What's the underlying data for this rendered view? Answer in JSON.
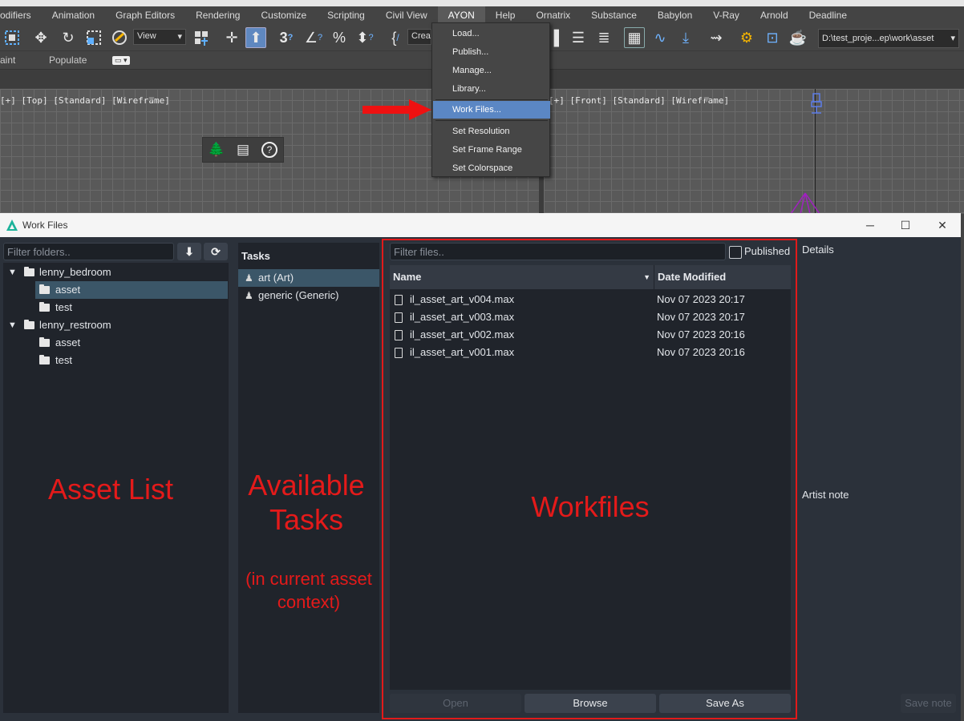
{
  "menubar": {
    "items": [
      "odifiers",
      "Animation",
      "Graph Editors",
      "Rendering",
      "Customize",
      "Scripting",
      "Civil View",
      "AYON",
      "Help",
      "Ornatrix",
      "Substance",
      "Babylon",
      "V-Ray",
      "Arnold",
      "Deadline"
    ],
    "active": "AYON"
  },
  "toolbar": {
    "view_select": "View",
    "create_select": "Crea",
    "project_path": "D:\\test_proje...ep\\work\\asset"
  },
  "subbar": {
    "left_label": "aint",
    "populate_label": "Populate"
  },
  "viewports": {
    "left_label": "[+] [Top] [Standard] [Wireframe]",
    "right_label": "[+] [Front] [Standard] [Wireframe]"
  },
  "ayon_menu": {
    "items": [
      "Load...",
      "Publish...",
      "Manage...",
      "Library...",
      "Work Files...",
      "Set Resolution",
      "Set Frame Range",
      "Set Colorspace"
    ],
    "highlighted": "Work Files..."
  },
  "workfiles": {
    "window_title": "Work Files",
    "folders": {
      "filter_placeholder": "Filter folders..",
      "tree": [
        {
          "label": "lenny_bedroom",
          "expanded": true,
          "children": [
            {
              "label": "asset",
              "selected": true
            },
            {
              "label": "test"
            }
          ]
        },
        {
          "label": "lenny_restroom",
          "expanded": true,
          "children": [
            {
              "label": "asset"
            },
            {
              "label": "test"
            }
          ]
        }
      ]
    },
    "tasks": {
      "header": "Tasks",
      "items": [
        {
          "label": "art (Art)",
          "selected": true
        },
        {
          "label": "generic (Generic)"
        }
      ]
    },
    "files": {
      "filter_placeholder": "Filter files..",
      "published_label": "Published",
      "columns": [
        "Name",
        "Date Modified"
      ],
      "rows": [
        {
          "name": "il_asset_art_v004.max",
          "date": "Nov 07 2023 20:17"
        },
        {
          "name": "il_asset_art_v003.max",
          "date": "Nov 07 2023 20:17"
        },
        {
          "name": "il_asset_art_v002.max",
          "date": "Nov 07 2023 20:16"
        },
        {
          "name": "il_asset_art_v001.max",
          "date": "Nov 07 2023 20:16"
        }
      ],
      "buttons": {
        "open": "Open",
        "browse": "Browse",
        "save_as": "Save As"
      }
    },
    "details": {
      "header": "Details",
      "artist_note": "Artist note",
      "save_note": "Save note"
    }
  },
  "annotations": {
    "asset_list": "Asset List",
    "available_tasks_line1": "Available",
    "available_tasks_line2": "Tasks",
    "context_line1": "(in current asset",
    "context_line2": "context)",
    "workfiles": "Workfiles"
  },
  "colors": {
    "annotation_red": "#e41a1a",
    "selection_blue": "#3b5668",
    "menu_highlight": "#5b87c4",
    "window_bg": "#2b313a",
    "panel_bg": "#20242b",
    "ayon_logo": "#1bb39a"
  },
  "icons": [
    "select-region-icon",
    "move-icon",
    "rotate-icon",
    "scale-icon",
    "selection-filter-icon",
    "snap-icon",
    "angle-snap-icon",
    "percent-snap-icon",
    "spinner-snap-icon",
    "edit-named-selection-icon",
    "layer-explorer-icon",
    "scene-explorer-icon",
    "curve-editor-icon",
    "schematic-view-icon",
    "render-setup-icon",
    "render-frame-icon",
    "render-icon",
    "tree-populate-icon",
    "list-icon",
    "help-icon"
  ]
}
